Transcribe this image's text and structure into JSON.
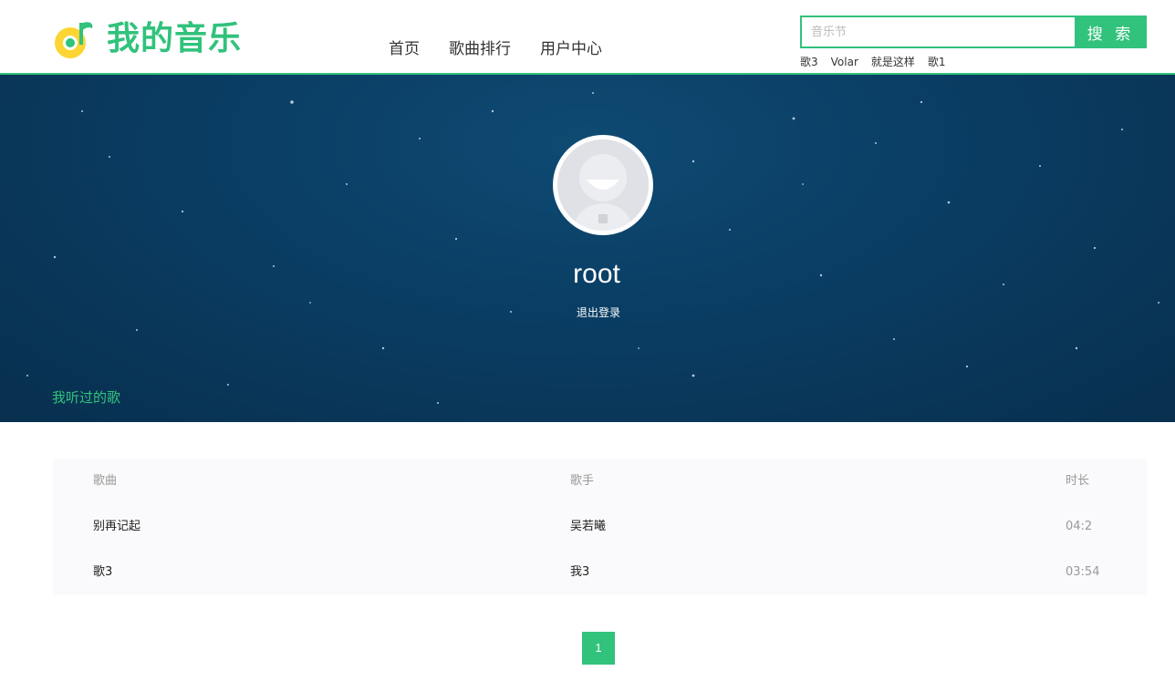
{
  "header": {
    "logo_text": "我的音乐",
    "nav": [
      "首页",
      "歌曲排行",
      "用户中心"
    ],
    "search_placeholder": "音乐节",
    "search_button": "搜 索",
    "hot_searches": [
      "歌3",
      "Volar",
      "就是这样",
      "歌1"
    ]
  },
  "profile": {
    "username": "root",
    "logout_label": "退出登录",
    "history_label": "我听过的歌"
  },
  "table": {
    "columns": {
      "song": "歌曲",
      "singer": "歌手",
      "duration": "时长"
    },
    "rows": [
      {
        "song": "别再记起",
        "singer": "吴若曦",
        "duration": "04:2"
      },
      {
        "song": "歌3",
        "singer": "我3",
        "duration": "03:54"
      }
    ]
  },
  "pagination": {
    "current": "1"
  },
  "colors": {
    "accent": "#31c27c",
    "banner": "#0a3d63"
  }
}
